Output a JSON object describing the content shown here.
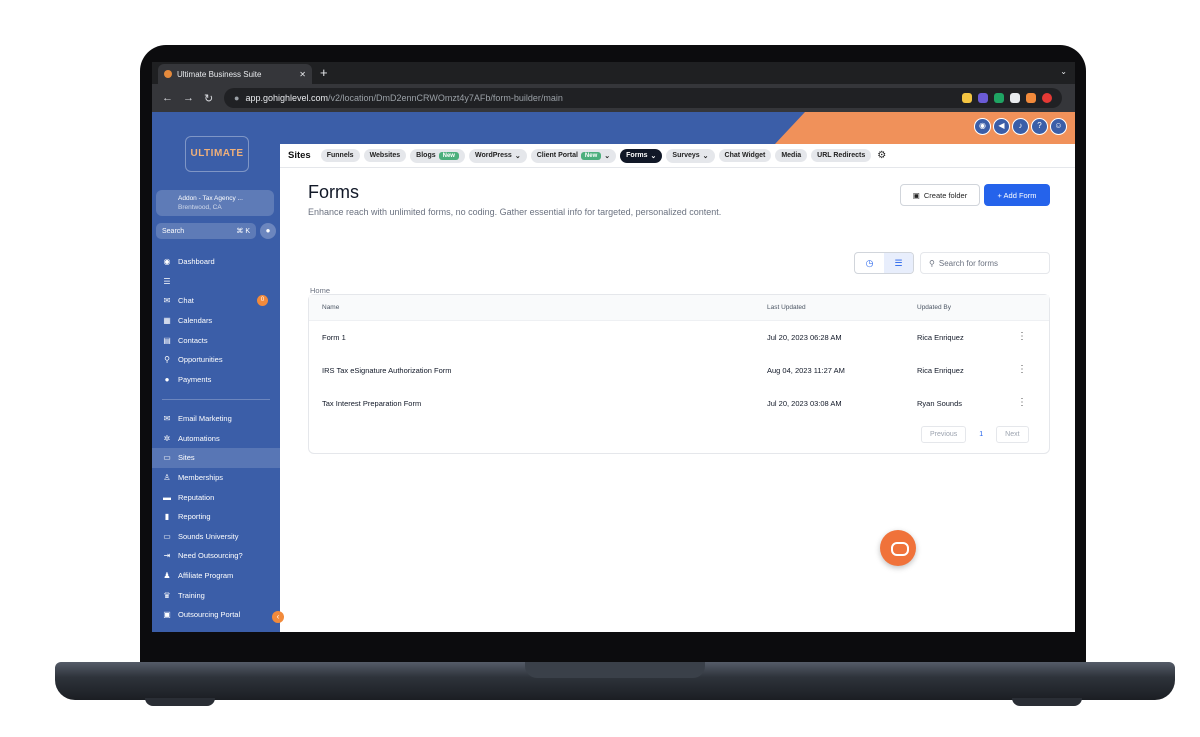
{
  "browser": {
    "tab_title": "Ultimate Business Suite",
    "url_host": "app.gohighlevel.com",
    "url_path": "/v2/location/DmD2ennCRWOmzt4y7AFb/form-builder/main"
  },
  "sidebar": {
    "logo_text": "ULTIMATE",
    "account_name": "Addon - Tax Agency ...",
    "account_location": "Brentwood, CA",
    "search_label": "Search",
    "search_shortcut": "⌘ K",
    "chat_badge": "0",
    "items_top": [
      {
        "label": "Dashboard",
        "icon": "dashboard-icon"
      },
      {
        "label": "",
        "icon": "list-icon"
      },
      {
        "label": "Chat",
        "icon": "chat-icon"
      },
      {
        "label": "Calendars",
        "icon": "calendar-icon"
      },
      {
        "label": "Contacts",
        "icon": "contacts-icon"
      },
      {
        "label": "Opportunities",
        "icon": "opportunities-icon"
      },
      {
        "label": "Payments",
        "icon": "payments-icon"
      }
    ],
    "items_bottom": [
      {
        "label": "Email Marketing",
        "icon": "email-icon"
      },
      {
        "label": "Automations",
        "icon": "automation-icon"
      },
      {
        "label": "Sites",
        "icon": "sites-icon"
      },
      {
        "label": "Memberships",
        "icon": "membership-icon"
      },
      {
        "label": "Reputation",
        "icon": "reputation-icon"
      },
      {
        "label": "Reporting",
        "icon": "reporting-icon"
      },
      {
        "label": "Sounds University",
        "icon": "monitor-icon"
      },
      {
        "label": "Need Outsourcing?",
        "icon": "outsourcing-icon"
      },
      {
        "label": "Affiliate Program",
        "icon": "affiliate-icon"
      },
      {
        "label": "Training",
        "icon": "crown-icon"
      },
      {
        "label": "Outsourcing Portal",
        "icon": "portal-icon"
      }
    ]
  },
  "subnav": {
    "title": "Sites",
    "items": [
      {
        "label": "Funnels"
      },
      {
        "label": "Websites"
      },
      {
        "label": "Blogs",
        "badge": "New"
      },
      {
        "label": "WordPress",
        "chevron": "⌄"
      },
      {
        "label": "Client Portal",
        "badge": "New",
        "chevron": "⌄"
      },
      {
        "label": "Forms",
        "chevron": "⌄"
      },
      {
        "label": "Surveys",
        "chevron": "⌄"
      },
      {
        "label": "Chat Widget"
      },
      {
        "label": "Media"
      },
      {
        "label": "URL Redirects"
      }
    ]
  },
  "page": {
    "title": "Forms",
    "description": "Enhance reach with unlimited forms, no coding. Gather essential info for targeted, personalized content.",
    "create_folder": "Create folder",
    "add_form": "+ Add Form",
    "search_placeholder": "Search for forms",
    "breadcrumb": "Home"
  },
  "table": {
    "headers": [
      "Name",
      "Last Updated",
      "Updated By"
    ],
    "rows": [
      {
        "name": "Form 1",
        "updated": "Jul 20, 2023 06:28 AM",
        "by": "Rica Enriquez"
      },
      {
        "name": "IRS Tax eSignature Authorization Form",
        "updated": "Aug 04, 2023 11:27 AM",
        "by": "Rica Enriquez"
      },
      {
        "name": "Tax Interest Preparation Form",
        "updated": "Jul 20, 2023 03:08 AM",
        "by": "Ryan Sounds"
      }
    ],
    "pagination": {
      "previous": "Previous",
      "current": "1",
      "next": "Next"
    }
  },
  "colors": {
    "sidebar": "#3b5ea8",
    "accent": "#2563eb",
    "orange": "#f0915a"
  }
}
